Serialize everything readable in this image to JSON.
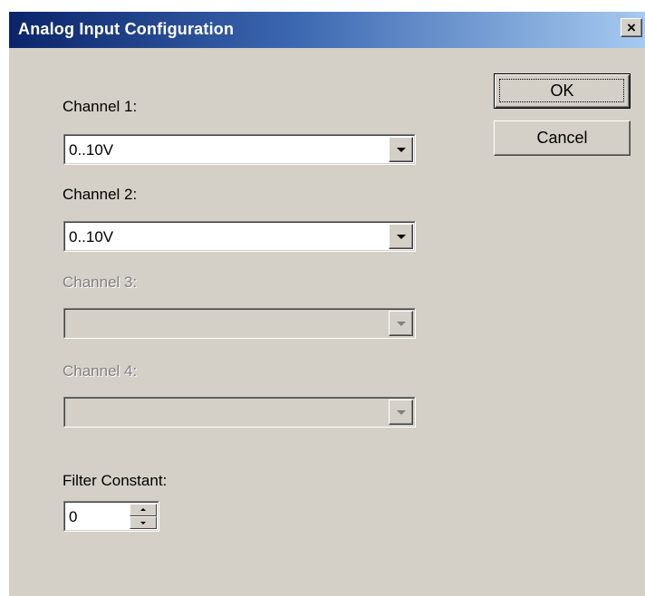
{
  "window": {
    "title": "Analog Input Configuration",
    "close_label": "×"
  },
  "buttons": {
    "ok": "OK",
    "cancel": "Cancel"
  },
  "channels": [
    {
      "label": "Channel 1:",
      "value": "0..10V",
      "enabled": true
    },
    {
      "label": "Channel 2:",
      "value": "0..10V",
      "enabled": true
    },
    {
      "label": "Channel 3:",
      "value": "",
      "enabled": false
    },
    {
      "label": "Channel 4:",
      "value": "",
      "enabled": false
    }
  ],
  "filter": {
    "label": "Filter Constant:",
    "value": "0"
  }
}
